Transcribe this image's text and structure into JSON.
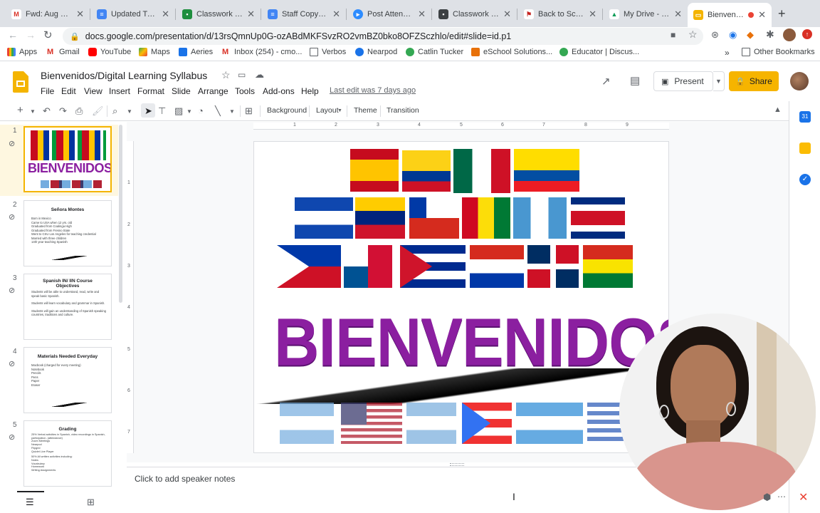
{
  "browser": {
    "tabs": [
      {
        "title": "Fwd: Aug & Se",
        "icon": "gmail-icon",
        "color": "#d93025"
      },
      {
        "title": "Updated Tutori",
        "icon": "docs-icon",
        "color": "#4285f4"
      },
      {
        "title": "Classwork for I",
        "icon": "classroom-icon",
        "color": "#1e8e3e"
      },
      {
        "title": "Staff Copy of S",
        "icon": "docs-icon",
        "color": "#4285f4"
      },
      {
        "title": "Post Attendee",
        "icon": "zoom-icon",
        "color": "#2d8cff"
      },
      {
        "title": "Classwork for I",
        "icon": "classroom-icon",
        "color": "#3c4043"
      },
      {
        "title": "Back to School",
        "icon": "flag-icon",
        "color": "#c5221f"
      },
      {
        "title": "My Drive - Goo",
        "icon": "drive-icon",
        "color": "#0f9d58"
      },
      {
        "title": "Bienvenido",
        "icon": "slides-icon",
        "color": "#f4b400"
      }
    ],
    "new_tab": "+",
    "url": "docs.google.com/presentation/d/13rsQmnUp0G-ozABdMKFSvzRO2vmBZ0bko8OFZSczhlo/edit#slide=id.p1",
    "bookmarks": [
      {
        "label": "Apps",
        "color": "#ea4335"
      },
      {
        "label": "Gmail",
        "color": "#d93025"
      },
      {
        "label": "YouTube",
        "color": "#ff0000"
      },
      {
        "label": "Maps",
        "color": "#34a853"
      },
      {
        "label": "Aeries",
        "color": "#1a73e8"
      },
      {
        "label": "Inbox (254) - cmo...",
        "color": "#d93025"
      },
      {
        "label": "Verbos",
        "color": "#5f6368"
      },
      {
        "label": "Nearpod",
        "color": "#1a73e8"
      },
      {
        "label": "Catlin Tucker",
        "color": "#34a853"
      },
      {
        "label": "eSchool Solutions...",
        "color": "#e8710a"
      },
      {
        "label": "Educator | Discus...",
        "color": "#34a853"
      }
    ],
    "bookmarks_more": "»",
    "other_bookmarks": "Other Bookmarks"
  },
  "app": {
    "title": "Bienvenidos/Digital Learning Syllabus",
    "menus": [
      "File",
      "Edit",
      "View",
      "Insert",
      "Format",
      "Slide",
      "Arrange",
      "Tools",
      "Add-ons",
      "Help"
    ],
    "last_edit": "Last edit was 7 days ago",
    "present": "Present",
    "share": "Share"
  },
  "toolbar": {
    "background": "Background",
    "layout": "Layout",
    "theme": "Theme",
    "transition": "Transition"
  },
  "slides": [
    {
      "num": "1",
      "title": "BIENVENIDOS"
    },
    {
      "num": "2",
      "title": "Señora Montes",
      "lines": [
        "Born in Mexico",
        "Came to USA when 12 yrs. old",
        "Graduated from Coalinga High",
        "Graduated from Fresno State",
        "Went to CSU Los Angeles for teaching credential",
        "Married with three children",
        "14th year teaching Spanish"
      ]
    },
    {
      "num": "3",
      "title": "Spanish IN/ IIN Course Objectives",
      "lines": [
        "Students will be able to understand, read, write and speak basic Spanish.",
        "",
        "Students will learn vocabulary and grammar in Spanish.",
        "",
        "Students will gain an understanding of Spanish speaking countries, traditions and culture."
      ]
    },
    {
      "num": "4",
      "title": "Materials Needed Everyday",
      "lines": [
        "Macbook (charged for every meeting)",
        "Notebook",
        "Pencils",
        "Pens",
        "Paper",
        "Eraser"
      ]
    },
    {
      "num": "5",
      "title": "Grading",
      "lines": [
        "25% Verbal activities in Spanish, video recordings in Spanish, participation, (attendance)",
        "Zoom Meetings",
        "Nearpod",
        "Flipgrid",
        "Quizlet Live Player",
        "",
        "50% All written activities including:",
        "Notes",
        "Vocabulary",
        "Homework",
        "Writing Assignments"
      ]
    }
  ],
  "ruler_h": [
    "1",
    "2",
    "3",
    "4",
    "5",
    "6",
    "7",
    "8",
    "9"
  ],
  "ruler_v": [
    "1",
    "2",
    "3",
    "4",
    "5",
    "6",
    "7"
  ],
  "slide_text": "BIENVENIDOS",
  "notes_placeholder": "Click to add speaker notes"
}
